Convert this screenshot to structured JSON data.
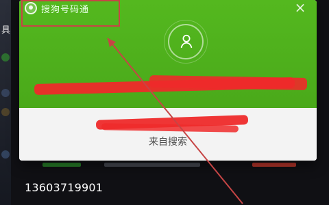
{
  "background": {
    "left_label": "具",
    "phone_number": "13603719901"
  },
  "popup": {
    "brand_title": "搜狗号码通",
    "close_symbol": "×",
    "source_label": "来自搜索"
  },
  "colors": {
    "popup_green": "#4aa91a",
    "redaction_red": "#ee2a2a",
    "annotation_red": "#c64545",
    "source_text": "#4d4d4d"
  },
  "icons": {
    "brand_icon": "phone-icon",
    "avatar_icon": "user-icon",
    "close_icon": "close-icon"
  }
}
